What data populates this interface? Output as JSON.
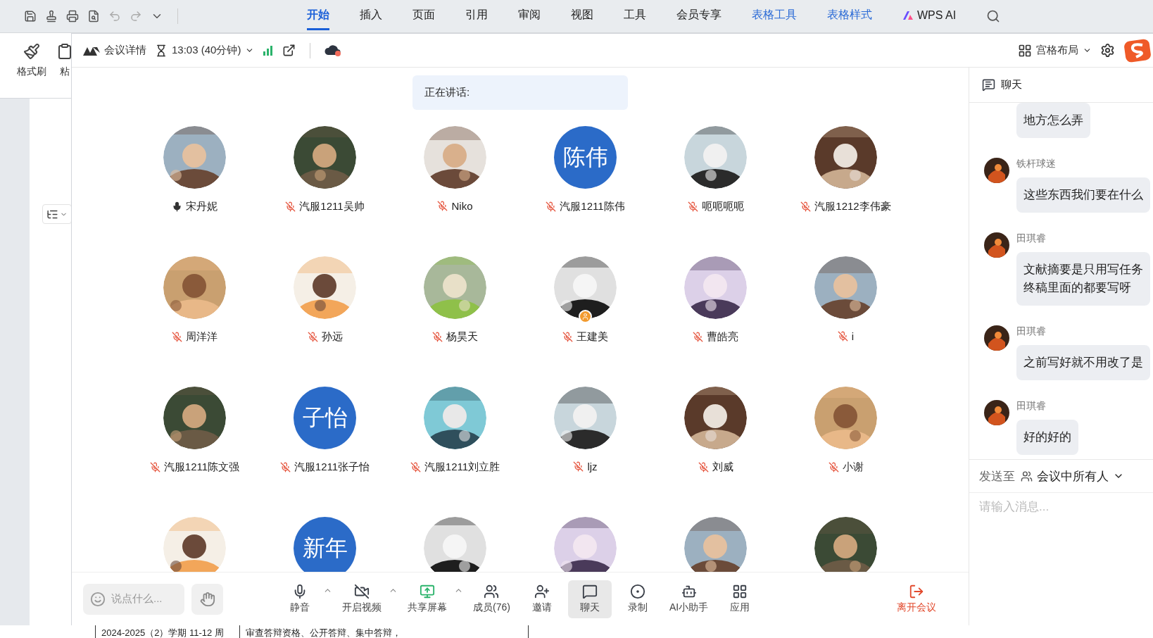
{
  "ribbon_tabs": [
    {
      "label": "开始",
      "selected": true,
      "kind": "main"
    },
    {
      "label": "插入",
      "selected": false,
      "kind": "main"
    },
    {
      "label": "页面",
      "selected": false,
      "kind": "main"
    },
    {
      "label": "引用",
      "selected": false,
      "kind": "main"
    },
    {
      "label": "审阅",
      "selected": false,
      "kind": "main"
    },
    {
      "label": "视图",
      "selected": false,
      "kind": "main"
    },
    {
      "label": "工具",
      "selected": false,
      "kind": "main"
    },
    {
      "label": "会员专享",
      "selected": false,
      "kind": "main"
    },
    {
      "label": "表格工具",
      "selected": false,
      "kind": "context"
    },
    {
      "label": "表格样式",
      "selected": false,
      "kind": "context"
    },
    {
      "label": "WPS AI",
      "selected": false,
      "kind": "ai"
    }
  ],
  "ribbon": {
    "items": [
      "格式刷",
      "粘"
    ]
  },
  "meeting": {
    "header": {
      "details": "会议详情",
      "time": "13:03 (40分钟)",
      "layout": "宫格布局"
    },
    "speaking": "正在讲话:",
    "participants": [
      {
        "name": "宋丹妮",
        "muted": false,
        "host": false,
        "avatar": {
          "kind": "picture"
        }
      },
      {
        "name": "汽服1211吴帅",
        "muted": true,
        "host": false,
        "avatar": {
          "kind": "picture"
        }
      },
      {
        "name": "Niko",
        "muted": true,
        "host": false,
        "avatar": {
          "kind": "picture"
        }
      },
      {
        "name": "汽服1211陈伟",
        "muted": true,
        "host": false,
        "avatar": {
          "kind": "initials",
          "text": "陈伟"
        }
      },
      {
        "name": "呃呃呃呃",
        "muted": true,
        "host": false,
        "avatar": {
          "kind": "picture"
        }
      },
      {
        "name": "汽服1212李伟豪",
        "muted": true,
        "host": false,
        "avatar": {
          "kind": "picture"
        }
      },
      {
        "name": "周洋洋",
        "muted": true,
        "host": false,
        "avatar": {
          "kind": "picture"
        }
      },
      {
        "name": "孙远",
        "muted": true,
        "host": false,
        "avatar": {
          "kind": "picture"
        }
      },
      {
        "name": "杨昊天",
        "muted": true,
        "host": false,
        "avatar": {
          "kind": "picture"
        }
      },
      {
        "name": "王建美",
        "muted": true,
        "host": true,
        "avatar": {
          "kind": "picture"
        }
      },
      {
        "name": "曹皓亮",
        "muted": true,
        "host": false,
        "avatar": {
          "kind": "picture"
        }
      },
      {
        "name": "i",
        "muted": true,
        "host": false,
        "avatar": {
          "kind": "picture"
        }
      },
      {
        "name": "汽服1211陈文强",
        "muted": true,
        "host": false,
        "avatar": {
          "kind": "picture"
        }
      },
      {
        "name": "汽服1211张子怡",
        "muted": true,
        "host": false,
        "avatar": {
          "kind": "initials",
          "text": "子怡"
        }
      },
      {
        "name": "汽服1211刘立胜",
        "muted": true,
        "host": false,
        "avatar": {
          "kind": "picture"
        }
      },
      {
        "name": "ljz",
        "muted": true,
        "host": false,
        "avatar": {
          "kind": "picture"
        }
      },
      {
        "name": "刘威",
        "muted": true,
        "host": false,
        "avatar": {
          "kind": "picture"
        }
      },
      {
        "name": "小谢",
        "muted": true,
        "host": false,
        "avatar": {
          "kind": "picture"
        }
      },
      {
        "avatar": {
          "kind": "picture"
        }
      },
      {
        "avatar": {
          "kind": "initials",
          "text": "新年"
        }
      },
      {
        "avatar": {
          "kind": "picture"
        }
      },
      {
        "avatar": {
          "kind": "picture"
        }
      },
      {
        "avatar": {
          "kind": "picture"
        }
      },
      {
        "avatar": {
          "kind": "picture"
        }
      }
    ],
    "message_box": {
      "placeholder": "说点什么..."
    },
    "controls": [
      {
        "label": "静音",
        "kind": "mic",
        "caret": true,
        "selected": false
      },
      {
        "label": "开启视频",
        "kind": "video",
        "caret": true,
        "selected": false
      },
      {
        "label": "共享屏幕",
        "kind": "share",
        "caret": true,
        "selected": false
      },
      {
        "label": "成员(76)",
        "kind": "members",
        "caret": false,
        "selected": false
      },
      {
        "label": "邀请",
        "kind": "invite",
        "caret": false,
        "selected": false
      },
      {
        "label": "聊天",
        "kind": "chat",
        "caret": false,
        "selected": true
      },
      {
        "label": "录制",
        "kind": "record",
        "caret": false,
        "selected": false
      },
      {
        "label": "AI小助手",
        "kind": "ai",
        "caret": false,
        "selected": false
      },
      {
        "label": "应用",
        "kind": "apps",
        "caret": false,
        "selected": false
      }
    ],
    "leave": "离开会议"
  },
  "chat": {
    "title": "聊天",
    "messages": [
      {
        "lines": [
          "地方怎么弄"
        ]
      },
      {
        "sender": "铁杆球迷",
        "lines": [
          "这些东西我们要在什么"
        ]
      },
      {
        "sender": "田琪睿",
        "lines": [
          "文献摘要是只用写任务",
          "终稿里面的都要写呀"
        ]
      },
      {
        "sender": "田琪睿",
        "lines": [
          "之前写好就不用改了是"
        ]
      },
      {
        "sender": "田琪睿",
        "lines": [
          "好的好的"
        ]
      }
    ],
    "send_to_label": "发送至",
    "recipient": "会议中所有人",
    "placeholder": "请输入消息..."
  },
  "document": {
    "cells": [
      "2024-2025（2）学期 11-12 周",
      "审查答辩资格、公开答辩、集中答辩，"
    ]
  }
}
